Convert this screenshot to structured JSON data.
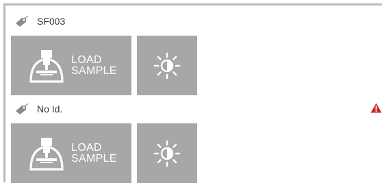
{
  "samples": [
    {
      "id": "SF003",
      "warning": false,
      "load_button": {
        "line1": "LOAD",
        "line2": "SAMPLE"
      }
    },
    {
      "id": "No Id.",
      "warning": true,
      "load_button": {
        "line1": "LOAD",
        "line2": "SAMPLE"
      }
    }
  ],
  "icons": {
    "tag": "tag-icon",
    "load": "sample-load-icon",
    "light": "brightness-icon",
    "warning": "warning-icon"
  },
  "colors": {
    "button_bg": "#a7a7a7",
    "button_fg": "#ffffff",
    "warning": "#cc2a2a",
    "panel_border": "#b9b9b9"
  }
}
